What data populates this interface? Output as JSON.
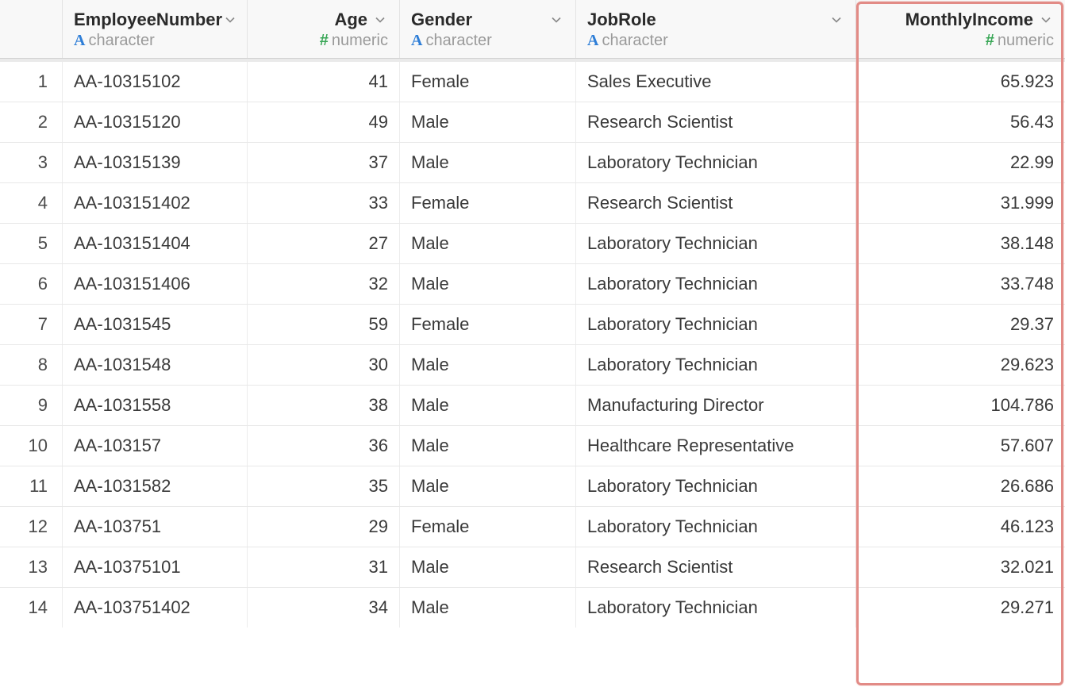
{
  "columns": [
    {
      "name": "EmployeeNumber",
      "type_label": "character",
      "type_kind": "char",
      "align": "left"
    },
    {
      "name": "Age",
      "type_label": "numeric",
      "type_kind": "num",
      "align": "right"
    },
    {
      "name": "Gender",
      "type_label": "character",
      "type_kind": "char",
      "align": "left"
    },
    {
      "name": "JobRole",
      "type_label": "character",
      "type_kind": "char",
      "align": "left"
    },
    {
      "name": "MonthlyIncome",
      "type_label": "numeric",
      "type_kind": "num",
      "align": "right"
    }
  ],
  "rows": [
    {
      "n": "1",
      "EmployeeNumber": "AA-10315102",
      "Age": "41",
      "Gender": "Female",
      "JobRole": "Sales Executive",
      "MonthlyIncome": "65.923"
    },
    {
      "n": "2",
      "EmployeeNumber": "AA-10315120",
      "Age": "49",
      "Gender": "Male",
      "JobRole": "Research Scientist",
      "MonthlyIncome": "56.43"
    },
    {
      "n": "3",
      "EmployeeNumber": "AA-10315139",
      "Age": "37",
      "Gender": "Male",
      "JobRole": "Laboratory Technician",
      "MonthlyIncome": "22.99"
    },
    {
      "n": "4",
      "EmployeeNumber": "AA-103151402",
      "Age": "33",
      "Gender": "Female",
      "JobRole": "Research Scientist",
      "MonthlyIncome": "31.999"
    },
    {
      "n": "5",
      "EmployeeNumber": "AA-103151404",
      "Age": "27",
      "Gender": "Male",
      "JobRole": "Laboratory Technician",
      "MonthlyIncome": "38.148"
    },
    {
      "n": "6",
      "EmployeeNumber": "AA-103151406",
      "Age": "32",
      "Gender": "Male",
      "JobRole": "Laboratory Technician",
      "MonthlyIncome": "33.748"
    },
    {
      "n": "7",
      "EmployeeNumber": "AA-1031545",
      "Age": "59",
      "Gender": "Female",
      "JobRole": "Laboratory Technician",
      "MonthlyIncome": "29.37"
    },
    {
      "n": "8",
      "EmployeeNumber": "AA-1031548",
      "Age": "30",
      "Gender": "Male",
      "JobRole": "Laboratory Technician",
      "MonthlyIncome": "29.623"
    },
    {
      "n": "9",
      "EmployeeNumber": "AA-1031558",
      "Age": "38",
      "Gender": "Male",
      "JobRole": "Manufacturing Director",
      "MonthlyIncome": "104.786"
    },
    {
      "n": "10",
      "EmployeeNumber": "AA-103157",
      "Age": "36",
      "Gender": "Male",
      "JobRole": "Healthcare Representative",
      "MonthlyIncome": "57.607"
    },
    {
      "n": "11",
      "EmployeeNumber": "AA-1031582",
      "Age": "35",
      "Gender": "Male",
      "JobRole": "Laboratory Technician",
      "MonthlyIncome": "26.686"
    },
    {
      "n": "12",
      "EmployeeNumber": "AA-103751",
      "Age": "29",
      "Gender": "Female",
      "JobRole": "Laboratory Technician",
      "MonthlyIncome": "46.123"
    },
    {
      "n": "13",
      "EmployeeNumber": "AA-10375101",
      "Age": "31",
      "Gender": "Male",
      "JobRole": "Research Scientist",
      "MonthlyIncome": "32.021"
    },
    {
      "n": "14",
      "EmployeeNumber": "AA-103751402",
      "Age": "34",
      "Gender": "Male",
      "JobRole": "Laboratory Technician",
      "MonthlyIncome": "29.271"
    }
  ],
  "icons": {
    "char_glyph": "A",
    "num_glyph": "#"
  }
}
